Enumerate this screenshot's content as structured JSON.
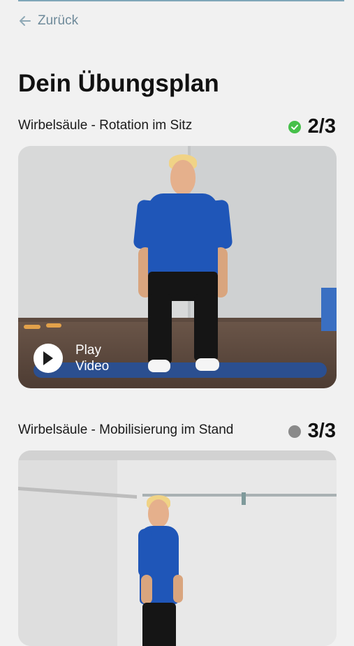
{
  "nav": {
    "back_label": "Zurück"
  },
  "page": {
    "title": "Dein Übungsplan"
  },
  "exercises": [
    {
      "title": "Wirbelsäule - Rotation im Sitz",
      "status": "completed",
      "status_color": "#46c04a",
      "count": "2/3",
      "play_label_1": "Play",
      "play_label_2": "Video"
    },
    {
      "title": "Wirbelsäule - Mobilisierung im Stand",
      "status": "pending",
      "status_color": "#8a8a8a",
      "count": "3/3"
    }
  ],
  "icons": {
    "back": "arrow-left-icon",
    "check": "check-circle-icon",
    "play": "play-icon"
  }
}
